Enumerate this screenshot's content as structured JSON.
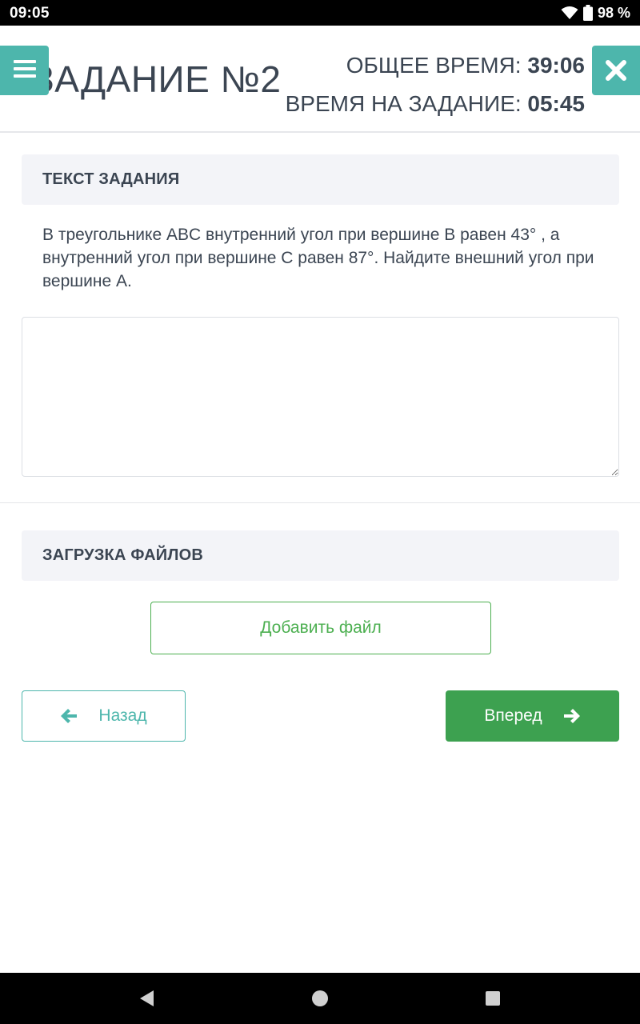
{
  "status_bar": {
    "time": "09:05",
    "battery": "98 %",
    "icons": [
      "wifi-icon",
      "battery-icon"
    ]
  },
  "header": {
    "title": "ЗАДАНИЕ №2",
    "total_time_label": "ОБЩЕЕ ВРЕМЯ:",
    "total_time_value": "39:06",
    "task_time_label": "ВРЕМЯ НА ЗАДАНИЕ:",
    "task_time_value": "05:45",
    "menu_icon": "hamburger-icon",
    "close_icon": "close-icon"
  },
  "task_section": {
    "heading": "ТЕКСТ ЗАДАНИЯ",
    "text": "В треугольнике ABC внутренний угол при вершине В равен 43° , а внутренний угол при вершине С равен 87°. Найдите внешний угол при вершине А."
  },
  "answer": {
    "value": "",
    "placeholder": ""
  },
  "upload_section": {
    "heading": "ЗАГРУЗКА ФАЙЛОВ",
    "add_file_label": "Добавить файл"
  },
  "navigation": {
    "back_label": "Назад",
    "next_label": "Вперед"
  },
  "colors": {
    "accent_teal": "#4db6ac",
    "accent_green": "#3da150",
    "text": "#3b4552",
    "section_bg": "#f3f4f8"
  }
}
